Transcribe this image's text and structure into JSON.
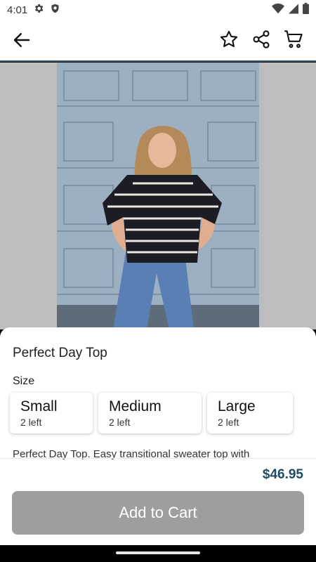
{
  "status": {
    "time": "4:01"
  },
  "app_bar": {},
  "product": {
    "title": "Perfect Day Top",
    "size_label": "Size",
    "sizes": [
      {
        "name": "Small",
        "stock": "2 left"
      },
      {
        "name": "Medium",
        "stock": "2 left"
      },
      {
        "name": "Large",
        "stock": "2 left"
      }
    ],
    "description": "Perfect Day Top. Easy transitional sweater top with",
    "price": "$46.95",
    "add_to_cart_label": "Add to Cart",
    "add_to_cart_color": "#9e9e9e",
    "price_color": "#1f4a66"
  }
}
